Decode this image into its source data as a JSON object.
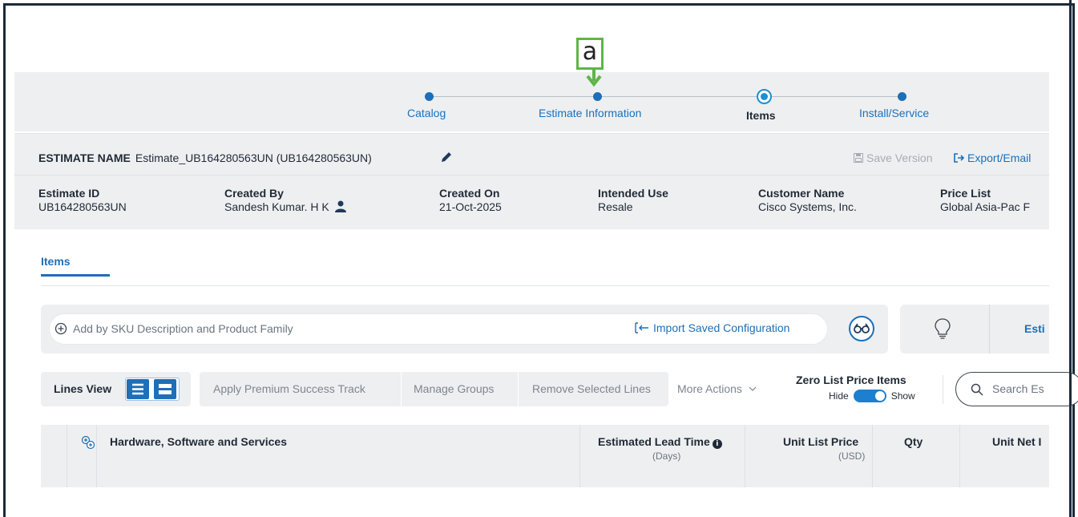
{
  "annotation": {
    "marker_label": "a"
  },
  "stepper": {
    "steps": [
      {
        "label": "Catalog",
        "state": "done"
      },
      {
        "label": "Estimate Information",
        "state": "done"
      },
      {
        "label": "Items",
        "state": "current"
      },
      {
        "label": "Install/Service",
        "state": "upcoming"
      }
    ]
  },
  "estimate": {
    "name_label": "ESTIMATE NAME",
    "name_value": "Estimate_UB164280563UN (UB164280563UN)",
    "save_version": "Save Version",
    "export_email": "Export/Email",
    "fields": [
      {
        "label": "Estimate ID",
        "value": "UB164280563UN"
      },
      {
        "label": "Created By",
        "value": "Sandesh Kumar. H K"
      },
      {
        "label": "Created On",
        "value": "21-Oct-2025"
      },
      {
        "label": "Intended Use",
        "value": "Resale"
      },
      {
        "label": "Customer Name",
        "value": "Cisco Systems, Inc."
      },
      {
        "label": "Price List",
        "value": "Global Asia-Pac F"
      }
    ]
  },
  "tabs": {
    "items_label": "Items"
  },
  "add_bar": {
    "placeholder": "Add by SKU Description and Product Family",
    "import_label": "Import Saved Configuration",
    "esti_label": "Esti"
  },
  "toolbar": {
    "lines_view": "Lines View",
    "actions": [
      "Apply Premium Success Track",
      "Manage Groups",
      "Remove Selected Lines"
    ],
    "more_actions": "More Actions",
    "zero_list_title": "Zero List Price Items",
    "hide": "Hide",
    "show": "Show",
    "search_placeholder": "Search Es"
  },
  "table": {
    "col_hw": "Hardware, Software and Services",
    "col_lead": "Estimated Lead Time",
    "col_lead_sub": "(Days)",
    "col_ulp": "Unit List Price",
    "col_ulp_sub": "(USD)",
    "col_qty": "Qty",
    "col_unp": "Unit Net I"
  },
  "colors": {
    "accent": "#1d6fb8",
    "panel": "#eeeff1",
    "marker": "#5fb547"
  }
}
